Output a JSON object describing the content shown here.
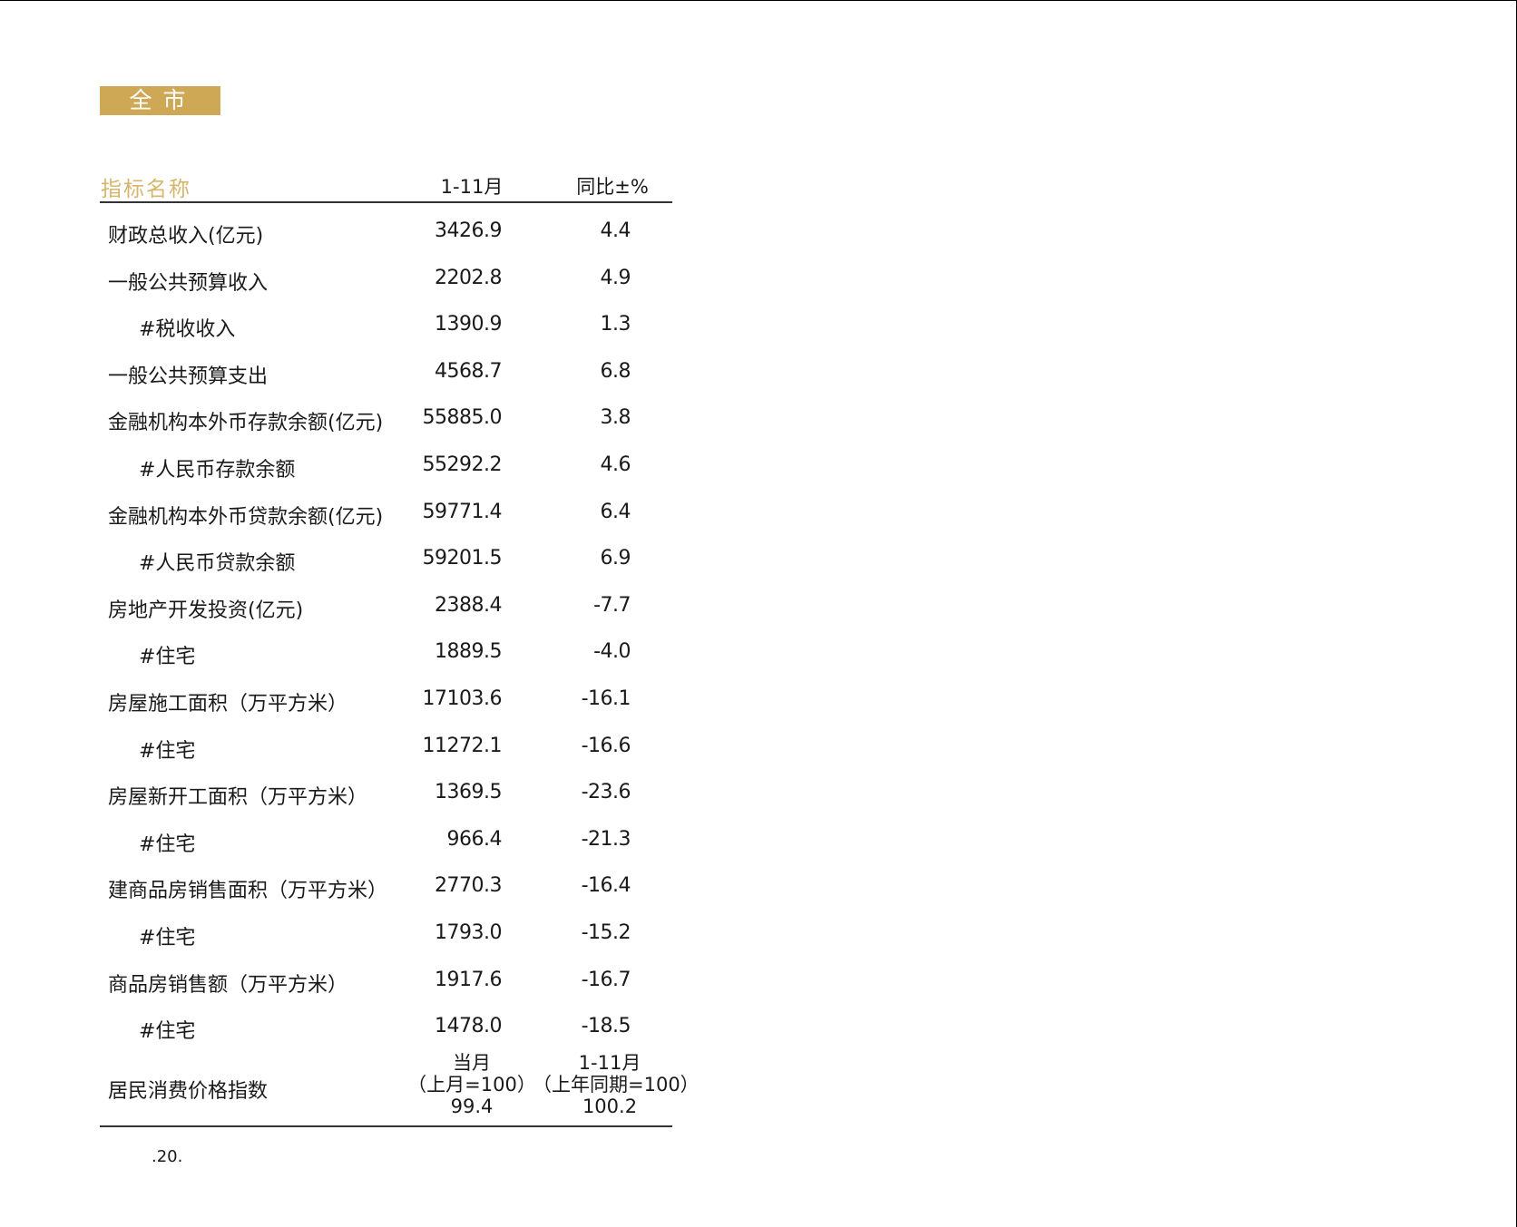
{
  "banner": "全市",
  "header": {
    "name": "指标名称",
    "col1": "1-11月",
    "col2": "同比±%"
  },
  "rows": [
    {
      "label": "财政总收入(亿元)",
      "v1": "3426.9",
      "v2": "4.4",
      "sub": false
    },
    {
      "label": "一般公共预算收入",
      "v1": "2202.8",
      "v2": "4.9",
      "sub": false
    },
    {
      "label": "#税收收入",
      "v1": "1390.9",
      "v2": "1.3",
      "sub": true
    },
    {
      "label": "一般公共预算支出",
      "v1": "4568.7",
      "v2": "6.8",
      "sub": false
    },
    {
      "label": "金融机构本外币存款余额(亿元)",
      "v1": "55885.0",
      "v2": "3.8",
      "sub": false
    },
    {
      "label": "#人民币存款余额",
      "v1": "55292.2",
      "v2": "4.6",
      "sub": true
    },
    {
      "label": "金融机构本外币贷款余额(亿元)",
      "v1": "59771.4",
      "v2": "6.4",
      "sub": false
    },
    {
      "label": "#人民币贷款余额",
      "v1": "59201.5",
      "v2": "6.9",
      "sub": true
    },
    {
      "label": "房地产开发投资(亿元)",
      "v1": "2388.4",
      "v2": "-7.7",
      "sub": false
    },
    {
      "label": "#住宅",
      "v1": "1889.5",
      "v2": "-4.0",
      "sub": true
    },
    {
      "label": "房屋施工面积（万平方米）",
      "v1": "17103.6",
      "v2": "-16.1",
      "sub": false
    },
    {
      "label": "#住宅",
      "v1": "11272.1",
      "v2": "-16.6",
      "sub": true
    },
    {
      "label": "房屋新开工面积（万平方米）",
      "v1": "1369.5",
      "v2": "-23.6",
      "sub": false
    },
    {
      "label": "#住宅",
      "v1": "966.4",
      "v2": "-21.3",
      "sub": true
    },
    {
      "label": "建商品房销售面积（万平方米）",
      "v1": "2770.3",
      "v2": "-16.4",
      "sub": false
    },
    {
      "label": "#住宅",
      "v1": "1793.0",
      "v2": "-15.2",
      "sub": true
    },
    {
      "label": "商品房销售额（万平方米）",
      "v1": "1917.6",
      "v2": "-16.7",
      "sub": false
    },
    {
      "label": "#住宅",
      "v1": "1478.0",
      "v2": "-18.5",
      "sub": true
    }
  ],
  "cpi": {
    "label": "居民消费价格指数",
    "col1": {
      "line1": "当月",
      "line2": "（上月=100）",
      "value": "99.4"
    },
    "col2": {
      "line1": "1-11月",
      "line2": "（上年同期=100）",
      "value": "100.2"
    }
  },
  "page_number": ".20.",
  "colors": {
    "accent": "#cfa856",
    "header_text": "#d6b56c"
  }
}
